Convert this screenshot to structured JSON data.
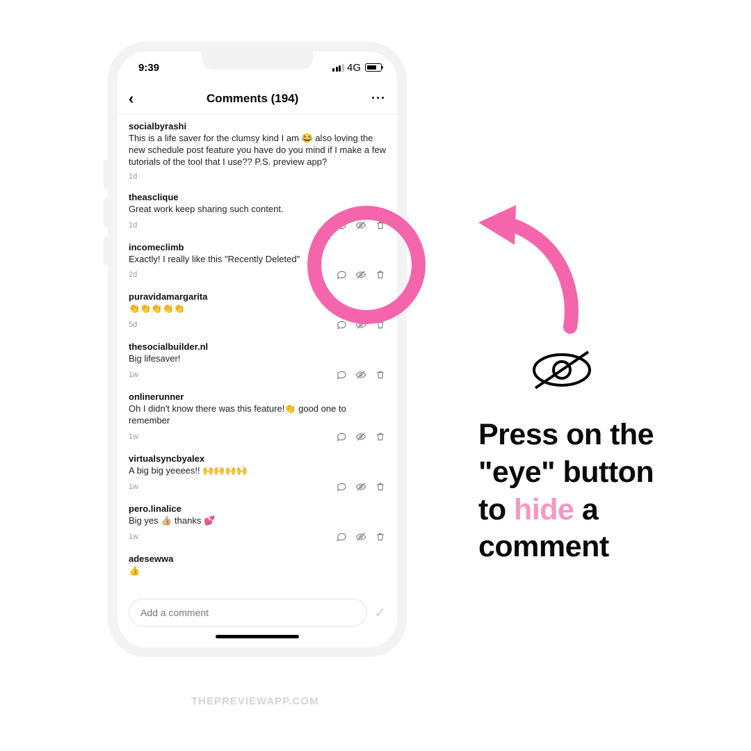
{
  "status": {
    "time": "9:39",
    "network": "4G"
  },
  "nav": {
    "title": "Comments (194)"
  },
  "comments": [
    {
      "user": "socialbyrashi",
      "text": "This is a life saver for the clumsy kind I am 😂 also loving the new schedule post feature you have do you mind if I make a few tutorials of the tool that I use?? P.S. preview app?",
      "time": "1d",
      "showActions": false
    },
    {
      "user": "theasclique",
      "text": "Great work keep sharing such content.",
      "time": "1d",
      "showActions": true
    },
    {
      "user": "incomeclimb",
      "text": "Exactly! I really like this \"Recently Deleted\"",
      "time": "2d",
      "showActions": true
    },
    {
      "user": "puravidamargarita",
      "text": "👏👏👏👏👏",
      "time": "5d",
      "showActions": true
    },
    {
      "user": "thesocialbuilder.nl",
      "text": "Big lifesaver!",
      "time": "1w",
      "showActions": true
    },
    {
      "user": "onlinerunner",
      "text": "Oh I didn't know there was this feature!👏 good one to remember",
      "time": "1w",
      "showActions": true
    },
    {
      "user": "virtualsyncbyalex",
      "text": "A big big yeeees!! 🙌🙌🙌🙌",
      "time": "1w",
      "showActions": true
    },
    {
      "user": "pero.linalice",
      "text": "Big yes 👍🏼 thanks 💕",
      "time": "1w",
      "showActions": true
    },
    {
      "user": "adesewwa",
      "text": "👍",
      "time": "",
      "showActions": false
    }
  ],
  "composer": {
    "placeholder": "Add a comment"
  },
  "callout": {
    "line1": "Press on the",
    "line2": "\"eye\" button",
    "line3_a": "to ",
    "line3_hide": "hide",
    "line3_b": " a",
    "line4": "comment"
  },
  "watermark": "THEPREVIEWAPP.COM"
}
